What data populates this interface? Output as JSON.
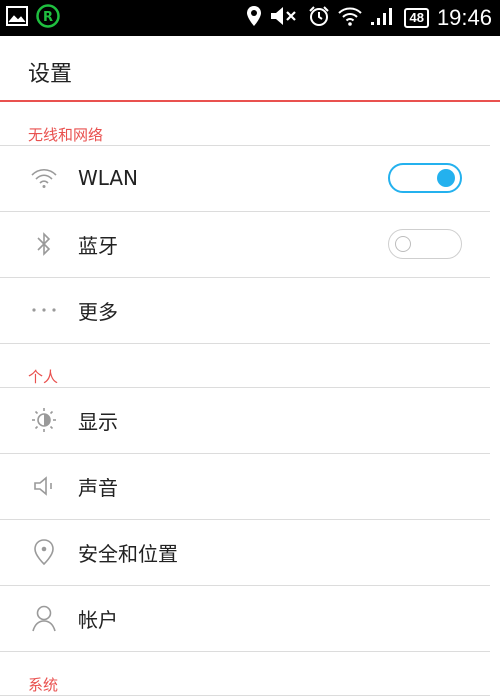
{
  "status_bar": {
    "time": "19:46",
    "battery": "48",
    "icons": [
      "image-icon",
      "app-r-icon",
      "location-icon",
      "mute-icon",
      "alarm-icon",
      "wifi-icon",
      "signal-icon"
    ]
  },
  "header": {
    "title": "设置"
  },
  "sections": [
    {
      "label": "无线和网络"
    },
    {
      "label": "个人"
    },
    {
      "label": "系统"
    }
  ],
  "items": [
    {
      "label": "WLAN",
      "icon": "wifi-icon",
      "toggle": "on"
    },
    {
      "label": "蓝牙",
      "icon": "bluetooth-icon",
      "toggle": "off"
    },
    {
      "label": "更多",
      "icon": "more-dots-icon"
    },
    {
      "label": "显示",
      "icon": "brightness-icon"
    },
    {
      "label": "声音",
      "icon": "speaker-icon"
    },
    {
      "label": "安全和位置",
      "icon": "location-pin-icon"
    },
    {
      "label": "帐户",
      "icon": "person-icon"
    }
  ],
  "colors": {
    "accent": "#e9514f",
    "toggle_on": "#24b1ee",
    "status_bar": "#000000"
  }
}
